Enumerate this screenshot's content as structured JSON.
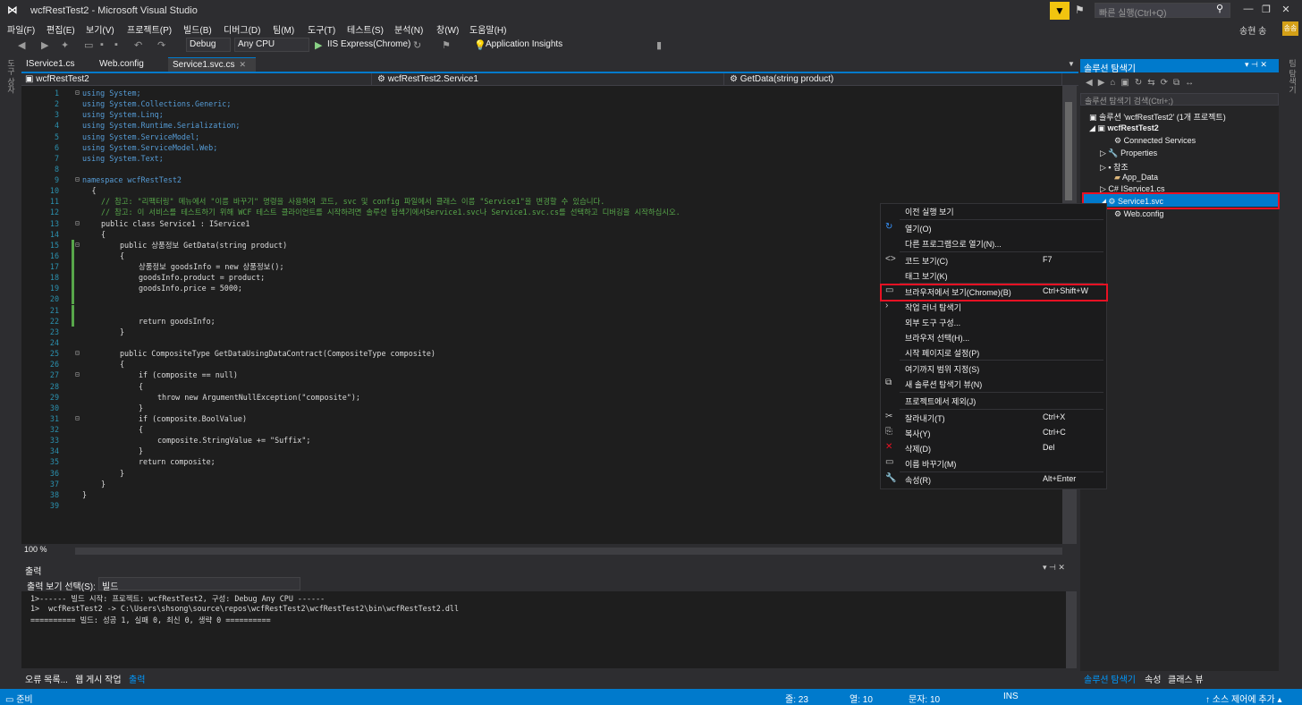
{
  "window": {
    "title": "wcfRestTest2 - Microsoft Visual Studio",
    "quick_launch": "빠른 실행(Ctrl+Q)",
    "user": "송현 송",
    "avatar": "송송"
  },
  "menu": [
    "파일(F)",
    "편집(E)",
    "보기(V)",
    "프로젝트(P)",
    "빌드(B)",
    "디버그(D)",
    "팀(M)",
    "도구(T)",
    "테스트(S)",
    "분석(N)",
    "창(W)",
    "도움말(H)"
  ],
  "toolbar": {
    "config": "Debug",
    "platform": "Any CPU",
    "run": "IIS Express(Chrome)",
    "insights": "Application Insights"
  },
  "left_strip": [
    "도구 상자"
  ],
  "right_strip": [
    "팀 탐색기"
  ],
  "tabs": [
    {
      "label": "IService1.cs"
    },
    {
      "label": "Web.config"
    },
    {
      "label": "Service1.svc.cs",
      "active": true
    }
  ],
  "navbar": {
    "project": "wcfRestTest2",
    "class": "wcfRestTest2.Service1",
    "member": "GetData(string product)"
  },
  "zoom": "100 %",
  "output": {
    "title": "출력",
    "show_label": "출력 보기 선택(S):",
    "show_value": "빌드",
    "lines": [
      "1>------ 빌드 시작: 프로젝트: wcfRestTest2, 구성: Debug Any CPU ------",
      "1>  wcfRestTest2 -> C:\\Users\\shsong\\source\\repos\\wcfRestTest2\\wcfRestTest2\\bin\\wcfRestTest2.dll",
      "========== 빌드: 성공 1, 실패 0, 최신 0, 생략 0 =========="
    ]
  },
  "bottom_tabs": [
    "오류 목록...",
    "웹 게시 작업",
    "출력"
  ],
  "solution_explorer": {
    "title": "솔루션 탐색기",
    "search": "솔루션 탐색기 검색(Ctrl+;)",
    "items": [
      "솔루션 'wcfRestTest2' (1개 프로젝트)",
      "wcfRestTest2",
      "Connected Services",
      "Properties",
      "참조",
      "App_Data",
      "IService1.cs",
      "Service1.svc",
      "Web.config"
    ],
    "bottom_tabs": [
      "솔루션 탐색기",
      "속성",
      "클래스 뷰"
    ]
  },
  "status": {
    "ready": "준비",
    "line": "줄: 23",
    "col": "열: 10",
    "char": "문자: 10",
    "ins": "INS",
    "source": "소스 제어에 추가"
  },
  "context_menu": [
    {
      "label": "이전 실행 보기",
      "shortcut": "",
      "icon": ""
    },
    {
      "label": "열기(O)",
      "shortcut": "",
      "icon": "↻"
    },
    {
      "label": "다른 프로그램으로 열기(N)...",
      "shortcut": "",
      "icon": ""
    },
    {
      "label": "코드 보기(C)",
      "shortcut": "F7",
      "icon": "<>"
    },
    {
      "label": "태그 보기(K)",
      "shortcut": "",
      "icon": ""
    },
    {
      "label": "브라우저에서 보기(Chrome)(B)",
      "shortcut": "Ctrl+Shift+W",
      "icon": "▭"
    },
    {
      "label": "작업 러너 탐색기",
      "shortcut": "",
      "icon": "›"
    },
    {
      "label": "외부 도구 구성...",
      "shortcut": "",
      "icon": ""
    },
    {
      "label": "브라우저 선택(H)...",
      "shortcut": "",
      "icon": ""
    },
    {
      "label": "시작 페이지로 설정(P)",
      "shortcut": "",
      "icon": ""
    },
    {
      "label": "여기까지 범위 지정(S)",
      "shortcut": "",
      "icon": ""
    },
    {
      "label": "새 솔루션 탐색기 뷰(N)",
      "shortcut": "",
      "icon": "⧉"
    },
    {
      "label": "프로젝트에서 제외(J)",
      "shortcut": "",
      "icon": ""
    },
    {
      "label": "잘라내기(T)",
      "shortcut": "Ctrl+X",
      "icon": "✂"
    },
    {
      "label": "복사(Y)",
      "shortcut": "Ctrl+C",
      "icon": "⎘"
    },
    {
      "label": "삭제(D)",
      "shortcut": "Del",
      "icon": "✕"
    },
    {
      "label": "이름 바꾸기(M)",
      "shortcut": "",
      "icon": "▭"
    },
    {
      "label": "속성(R)",
      "shortcut": "Alt+Enter",
      "icon": "🔧"
    }
  ],
  "code_lines": [
    "1",
    "2",
    "3",
    "4",
    "5",
    "6",
    "7",
    "8",
    "9",
    "10",
    "11",
    "12",
    "13",
    "14",
    "15",
    "16",
    "17",
    "18",
    "19",
    "20",
    "21",
    "22",
    "23",
    "24",
    "25",
    "26",
    "27",
    "28",
    "29",
    "30",
    "31",
    "32",
    "33",
    "34",
    "35",
    "36",
    "37",
    "38",
    "39"
  ],
  "code": {
    "l1": "using System;",
    "l2": "using System.Collections.Generic;",
    "l3": "using System.Linq;",
    "l4": "using System.Runtime.Serialization;",
    "l5": "using System.ServiceModel;",
    "l6": "using System.ServiceModel.Web;",
    "l7": "using System.Text;",
    "l9": "namespace wcfRestTest2",
    "l11": "// 참고: \"리팩터링\" 메뉴에서 \"이름 바꾸기\" 명령을 사용하여 코드, svc 및 config 파일에서 클래스 이름 \"Service1\"을 변경할 수 있습니다.",
    "l12": "// 참고: 이 서비스를 테스트하기 위해 WCF 테스트 클라이언트를 시작하려면 솔루션 탐색기에서Service1.svc나 Service1.svc.cs를 선택하고 디버깅을 시작하십시오.",
    "l13": "public class Service1 : IService1",
    "l15": "public 상품정보 GetData(string product)",
    "l17": "상품정보 goodsInfo = new 상품정보();",
    "l18": "goodsInfo.product = product;",
    "l19": "goodsInfo.price = 5000;",
    "l22": "return goodsInfo;",
    "l25": "public CompositeType GetDataUsingDataContract(CompositeType composite)",
    "l27": "if (composite == null)",
    "l29": "throw new ArgumentNullException(\"composite\");",
    "l31": "if (composite.BoolValue)",
    "l33": "composite.StringValue += \"Suffix\";",
    "l35": "return composite;"
  }
}
